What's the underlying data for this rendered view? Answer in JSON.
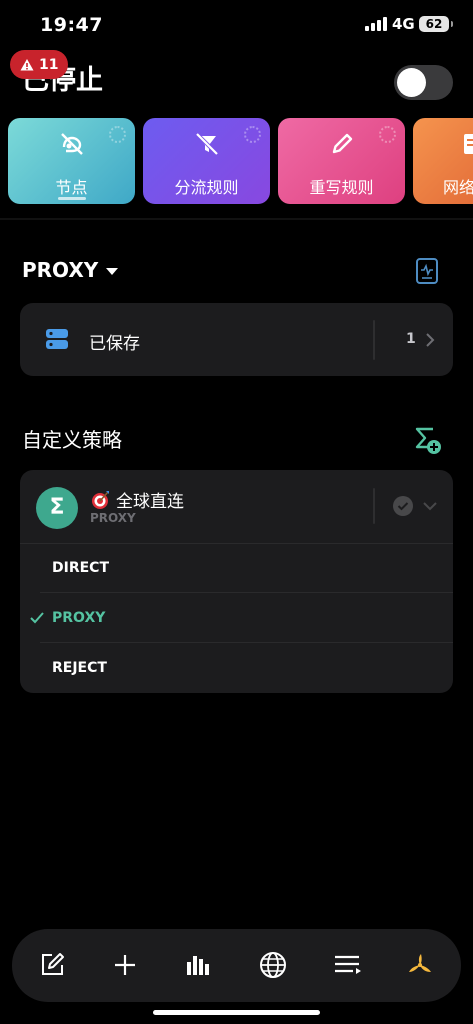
{
  "status_bar": {
    "time": "19:47",
    "network": "4G",
    "battery": "62"
  },
  "header": {
    "title": "已停止",
    "alert_count": "11",
    "toggle_on": false
  },
  "tiles": [
    {
      "label": "节点",
      "color": "#3fa8c7",
      "icon": "node-off-icon",
      "active": true
    },
    {
      "label": "分流规则",
      "color": "#7a52e8",
      "icon": "rule-off-icon",
      "active": false
    },
    {
      "label": "重写规则",
      "color": "#e4508c",
      "icon": "pencil-icon",
      "active": false
    },
    {
      "label": "网络",
      "color": "#e97a40",
      "icon": "document-icon",
      "active": false
    }
  ],
  "proxy_section": {
    "title": "PROXY",
    "saved": {
      "label": "已保存",
      "count": "1"
    }
  },
  "custom_section": {
    "title": "自定义策略",
    "policy": {
      "avatar": "Σ",
      "name": "全球直连",
      "subtitle": "PROXY",
      "options": [
        {
          "label": "DIRECT",
          "selected": false
        },
        {
          "label": "PROXY",
          "selected": true
        },
        {
          "label": "REJECT",
          "selected": false
        }
      ]
    }
  },
  "toolbar": {
    "items": [
      "edit-icon",
      "add-icon",
      "stats-icon",
      "globe-icon",
      "list-icon",
      "fan-icon"
    ],
    "accent": "#f5b83d"
  },
  "colors": {
    "accent_green": "#55c3a2",
    "alert_red": "#c8232c"
  }
}
